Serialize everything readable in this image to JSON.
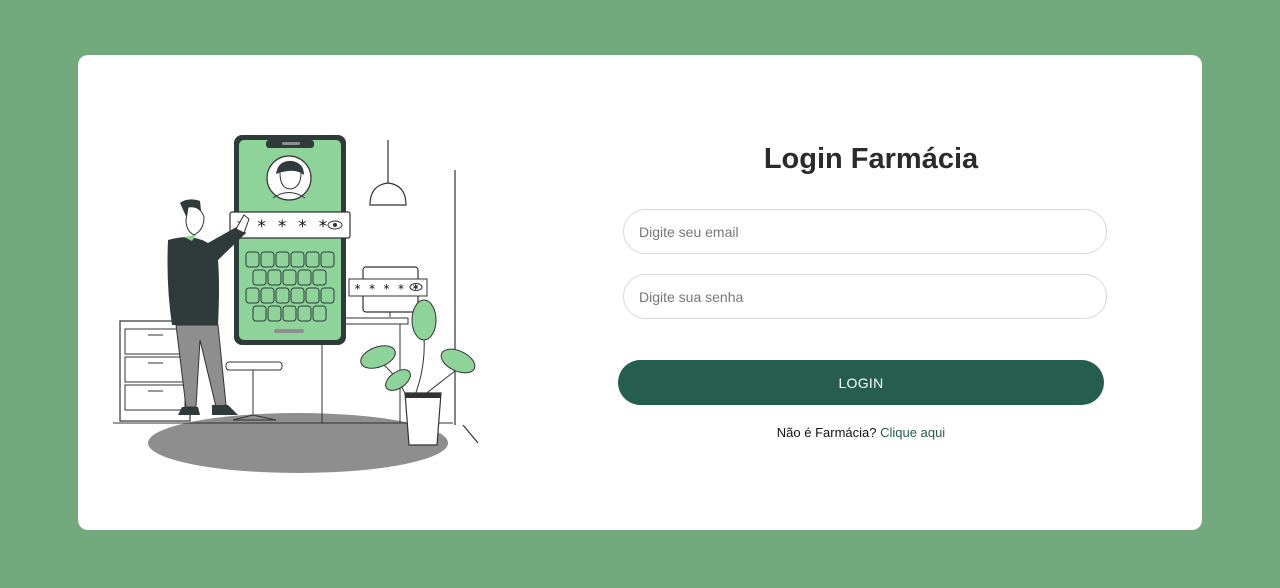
{
  "login": {
    "title": "Login Farmácia",
    "email_placeholder": "Digite seu email",
    "password_placeholder": "Digite sua senha",
    "submit_label": "LOGIN",
    "signup_prompt": "Não é Farmácia?",
    "signup_link": "Clique aqui"
  },
  "illustration": {
    "phone_password_mask": "* * * * *",
    "monitor_password_mask": "* * * * *",
    "icons": [
      "eye-icon",
      "user-avatar-icon",
      "pendant-lamp-icon",
      "plant-icon"
    ]
  },
  "colors": {
    "background": "#72aa7e",
    "card": "#ffffff",
    "primary": "#255d4f",
    "accent_green": "#8ed39a"
  }
}
